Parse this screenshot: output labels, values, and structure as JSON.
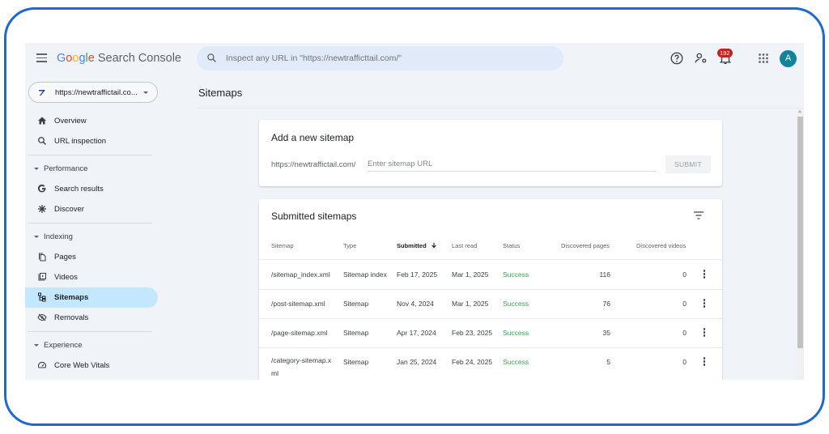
{
  "header": {
    "logo": {
      "g1": "G",
      "g2": "o",
      "g3": "o",
      "g4": "g",
      "g5": "l",
      "g6": "e",
      "product": "Search Console"
    },
    "search_placeholder": "Inspect any URL in \"https://newtrafficttail.com/\"",
    "notifications_count": "192",
    "avatar_letter": "A",
    "icons": [
      "menu-icon",
      "search-icon",
      "help-icon",
      "manage-users-icon",
      "notifications-icon",
      "apps-grid-icon",
      "avatar"
    ]
  },
  "property": {
    "label": "https://newtraffictail.co..."
  },
  "page": {
    "title": "Sitemaps"
  },
  "sidebar": {
    "items": [
      {
        "label": "Overview",
        "icon": "home-icon"
      },
      {
        "label": "URL inspection",
        "icon": "search-icon"
      }
    ],
    "sections": [
      {
        "label": "Performance",
        "items": [
          {
            "label": "Search results",
            "icon": "google-g-icon"
          },
          {
            "label": "Discover",
            "icon": "asterisk-icon"
          }
        ]
      },
      {
        "label": "Indexing",
        "items": [
          {
            "label": "Pages",
            "icon": "pages-icon"
          },
          {
            "label": "Videos",
            "icon": "videos-icon"
          },
          {
            "label": "Sitemaps",
            "icon": "sitemap-icon",
            "active": true
          },
          {
            "label": "Removals",
            "icon": "removals-icon"
          }
        ]
      },
      {
        "label": "Experience",
        "items": [
          {
            "label": "Core Web Vitals",
            "icon": "gauge-icon"
          }
        ]
      }
    ]
  },
  "add_sitemap": {
    "title": "Add a new sitemap",
    "prefix": "https://newtraffictail.com/",
    "input_placeholder": "Enter sitemap URL",
    "input_value": "",
    "submit_label": "SUBMIT"
  },
  "submitted": {
    "title": "Submitted sitemaps",
    "columns": [
      "Sitemap",
      "Type",
      "Submitted",
      "Last read",
      "Status",
      "Discovered pages",
      "Discovered videos"
    ],
    "sorted_column": "Submitted",
    "rows": [
      {
        "sitemap": "/sitemap_index.xml",
        "type": "Sitemap index",
        "submitted": "Feb 17, 2025",
        "last_read": "Mar 1, 2025",
        "status": "Success",
        "pages": "116",
        "videos": "0"
      },
      {
        "sitemap": "/post-sitemap.xml",
        "type": "Sitemap",
        "submitted": "Nov 4, 2024",
        "last_read": "Mar 1, 2025",
        "status": "Success",
        "pages": "76",
        "videos": "0"
      },
      {
        "sitemap": "/page-sitemap.xml",
        "type": "Sitemap",
        "submitted": "Apr 17, 2024",
        "last_read": "Feb 23, 2025",
        "status": "Success",
        "pages": "35",
        "videos": "0"
      },
      {
        "sitemap": "/category-sitemap.xml",
        "type": "Sitemap",
        "submitted": "Jan 25, 2024",
        "last_read": "Feb 24, 2025",
        "status": "Success",
        "pages": "5",
        "videos": "0"
      }
    ]
  },
  "colors": {
    "frame": "#1f67d2",
    "accent": "#4285f4",
    "success": "#34a853",
    "active_nav": "#c2e7ff",
    "badge": "#c5221f",
    "avatar": "#11839a"
  }
}
